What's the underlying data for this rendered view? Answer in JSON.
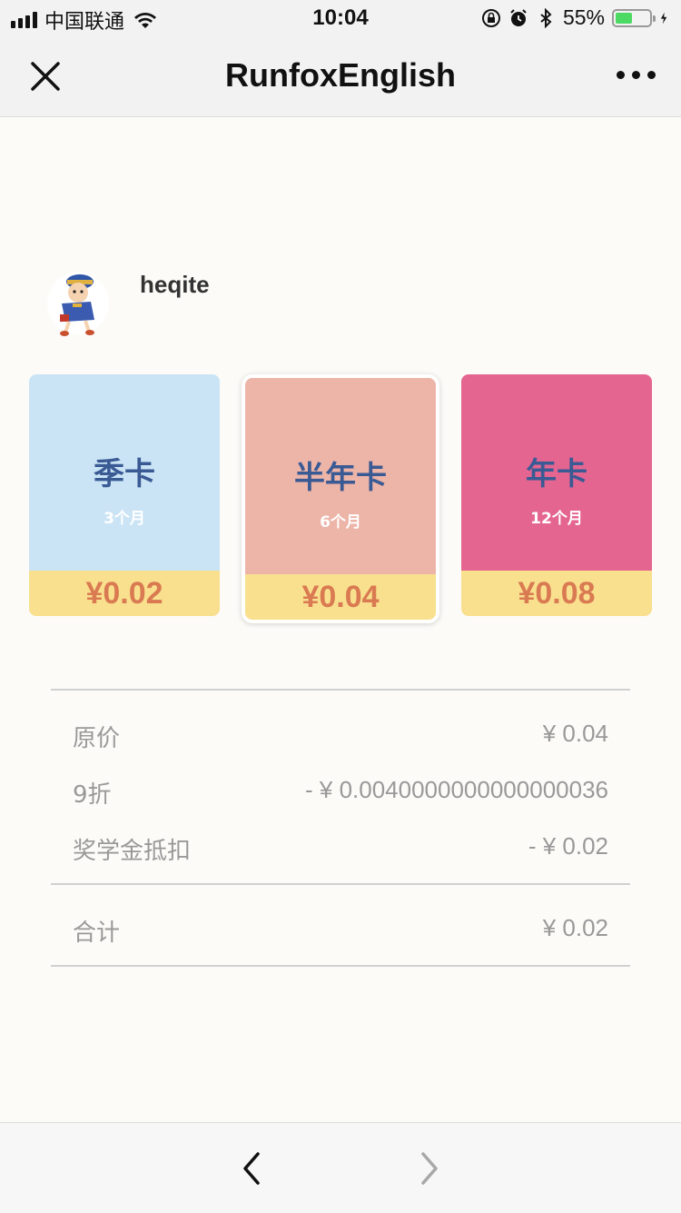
{
  "status_bar": {
    "carrier": "中国联通",
    "time": "10:04",
    "battery_percent": "55%",
    "battery_level": 0.55,
    "battery_color": "#4cd964",
    "icons": [
      "signal-icon",
      "wifi-icon",
      "rotation-lock-icon",
      "alarm-icon",
      "bluetooth-icon",
      "battery-icon",
      "charging-icon"
    ]
  },
  "nav": {
    "title": "RunfoxEnglish",
    "close_icon": "close-icon",
    "more_icon": "more-icon"
  },
  "user": {
    "name": "heqite",
    "avatar": "cartoon-boy-avatar"
  },
  "cards": [
    {
      "name": "季卡",
      "duration": "3个月",
      "price": "¥0.02",
      "color": "#cae4f6",
      "selected": false
    },
    {
      "name": "半年卡",
      "duration": "6个月",
      "price": "¥0.04",
      "color": "#edb4a8",
      "selected": true
    },
    {
      "name": "年卡",
      "duration": "12个月",
      "price": "¥0.08",
      "color": "#e56591",
      "selected": false
    }
  ],
  "summary": {
    "original_label": "原价",
    "original_value": "¥ 0.04",
    "discount_label": "9折",
    "discount_value": "- ¥ 0.0040000000000000036",
    "scholarship_label": "奖学金抵扣",
    "scholarship_value": "- ¥ 0.02",
    "total_label": "合计",
    "total_value": "¥ 0.02"
  },
  "toolbar": {
    "back_icon": "chevron-left-icon",
    "forward_icon": "chevron-right-icon"
  },
  "colors": {
    "price_band": "#f9e08e",
    "price_text": "#d97a52",
    "card_title": "#3a5a94"
  }
}
